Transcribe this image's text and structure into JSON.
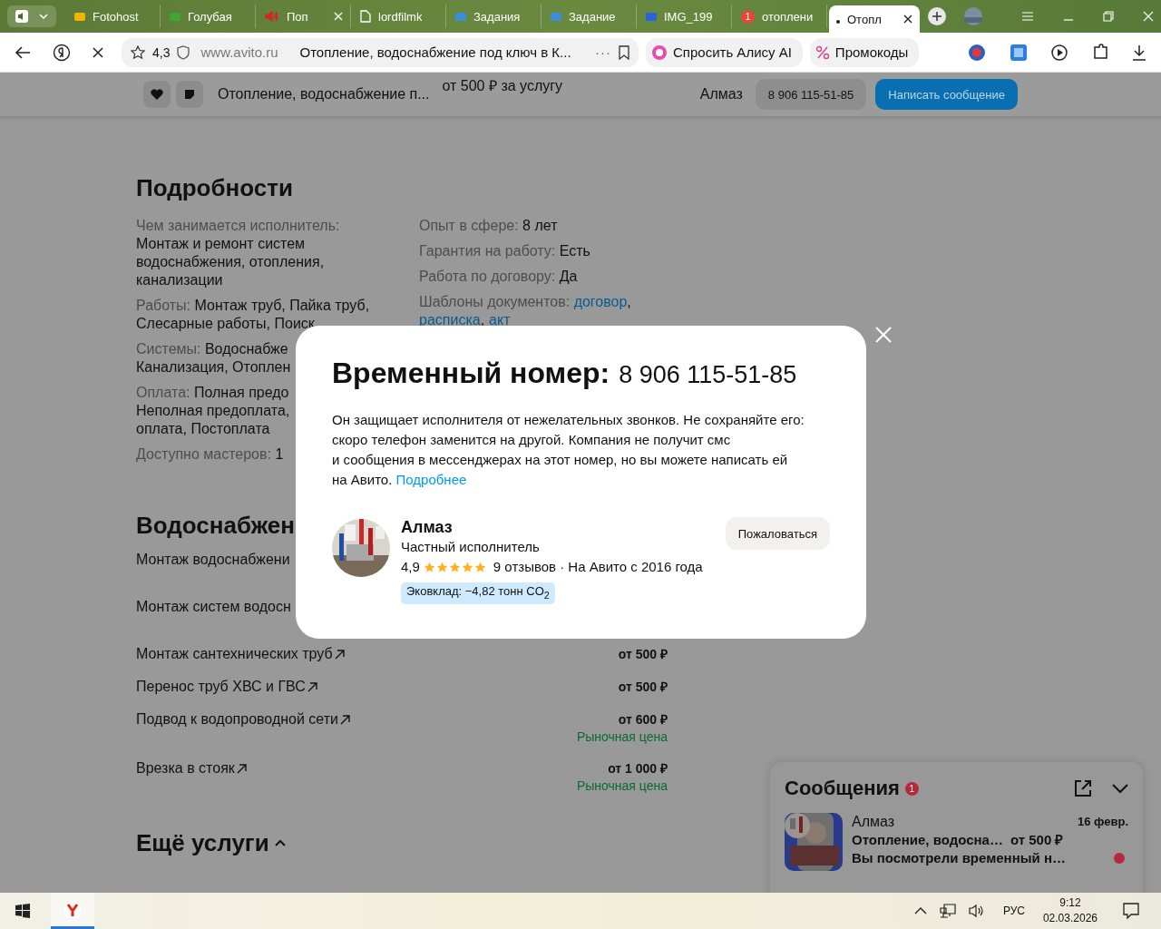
{
  "browser": {
    "tabs": [
      {
        "title": "Fotohost",
        "selected": false
      },
      {
        "title": "Голубая",
        "selected": false
      },
      {
        "title": "Поп",
        "selected": false,
        "closable": true
      },
      {
        "title": "lordfilmk",
        "selected": false
      },
      {
        "title": "Задания",
        "selected": false
      },
      {
        "title": "Задание",
        "selected": false
      },
      {
        "title": "IMG_199",
        "selected": false
      },
      {
        "title": "отоплени",
        "badge": "1",
        "selected": false
      },
      {
        "title": "Отопл",
        "selected": true,
        "closable": true
      }
    ],
    "rating": "4,3",
    "domain": "www.avito.ru",
    "page_title": "Отопление, водоснабжение под ключ в К...",
    "more": "···",
    "alice": "Спросить Алису AI",
    "promo": "Промокоды"
  },
  "header": {
    "title": "Отопление, водоснабжение п...",
    "price": "от 500 ₽ за услугу",
    "seller": "Алмаз",
    "phone": "8 906 115-51-85",
    "write_button": "Написать сообщение"
  },
  "details": {
    "title": "Подробности",
    "left": [
      {
        "kind": "stacked",
        "label": "Чем занимается исполнитель:",
        "lines": [
          "Монтаж и ремонт систем",
          "водоснабжения, отопления,",
          "канализации"
        ]
      },
      {
        "kind": "inline",
        "label": "Работы:",
        "lines": [
          "Монтаж труб, Пайка труб,",
          "Слесарные работы, Поиск"
        ]
      },
      {
        "kind": "inline",
        "label": "Системы:",
        "lines": [
          "Водоснабже",
          "Канализация, Отоплен"
        ]
      },
      {
        "kind": "inline",
        "label": "Оплата:",
        "lines": [
          "Полная предо",
          "Неполная предоплата,",
          "оплата, Постоплата"
        ]
      },
      {
        "kind": "inline",
        "label": "Доступно мастеров:",
        "lines": [
          "1"
        ]
      }
    ],
    "right": [
      {
        "label": "Опыт в сфере:",
        "value": "8 лет"
      },
      {
        "label": "Гарантия на работу:",
        "value": "Есть"
      },
      {
        "label": "Работа по договору:",
        "value": "Да"
      },
      {
        "label": "Шаблоны документов:",
        "links": [
          "договор",
          "расписка",
          "акт"
        ],
        "separator": ","
      }
    ]
  },
  "services": {
    "title": "Водоснабжен",
    "rows": [
      {
        "kind": "cut",
        "name": "Монтаж водоснабжени"
      },
      {
        "kind": "cut",
        "name": "Монтаж систем водосн"
      },
      {
        "kind": "link",
        "name": "Монтаж сантехнических труб",
        "price": "от 500 ₽"
      },
      {
        "kind": "link",
        "name": "Перенос труб ХВС и ГВС",
        "price": "от 500 ₽"
      },
      {
        "kind": "link",
        "name": "Подвод к водопроводной сети",
        "price": "от 600 ₽",
        "note": "Рыночная цена"
      },
      {
        "kind": "link",
        "name": "Врезка в стояк",
        "price": "от 1 000 ₽",
        "note": "Рыночная цена"
      }
    ],
    "more": "Ещё услуги",
    "expanded": true
  },
  "modal": {
    "title": "Временный номер:",
    "phone": "8 906 115-51-85",
    "text_lines": [
      "Он защищает исполнителя от нежелательных звонков. Не сохраняйте его:",
      "скоро телефон заменится на другой. Компания не получит смс",
      "и сообщения в мессенджерах на этот номер, но вы можете написать ей",
      "на Авито."
    ],
    "link": "Подробнее",
    "name": "Алмаз",
    "type": "Частный исполнитель",
    "rating": "4,9",
    "stars": 5,
    "reviews": "9 отзывов · На Авито с 2016 года",
    "eco": "Эковклад: −4,82 тонн CO$_{2}$",
    "report_button": "Пожаловаться"
  },
  "messages": {
    "title": "Сообщения",
    "unread": "1",
    "chats": [
      {
        "name": "Алмаз",
        "date": "16 февр.",
        "subject": "Отопление, водосна…",
        "price": "от 500 ₽",
        "preview": "Вы посмотрели временный н…",
        "unread": true
      }
    ]
  },
  "taskbar": {
    "language": "РУС",
    "time": "9:12",
    "date": "02.03.2026"
  }
}
